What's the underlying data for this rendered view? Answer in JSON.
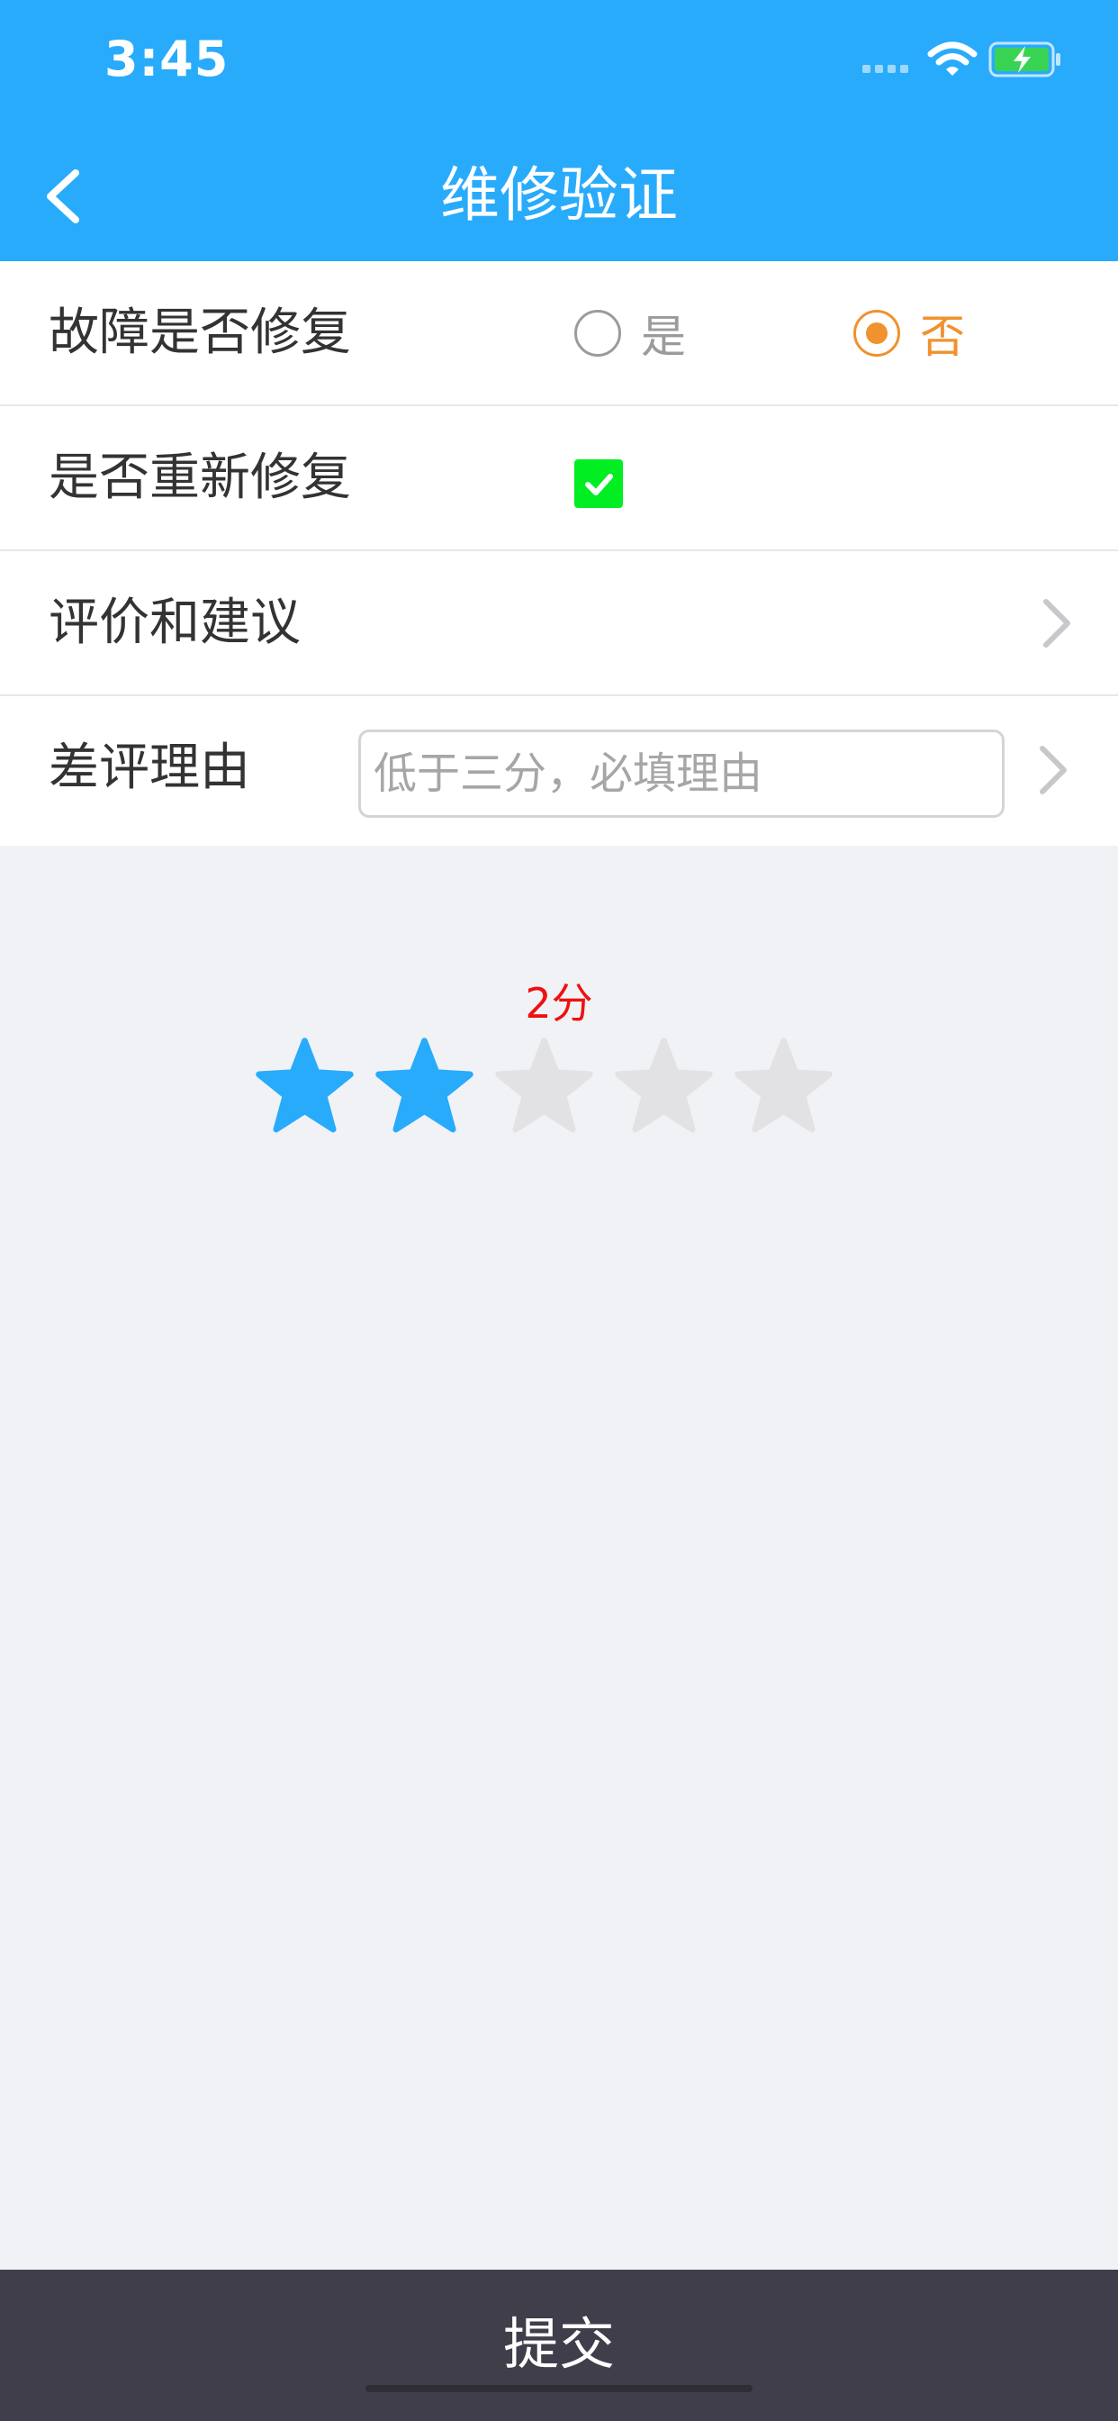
{
  "status_bar": {
    "time": "3:45",
    "icons": [
      "signal-icon",
      "wifi-icon",
      "battery-charging-icon"
    ]
  },
  "nav": {
    "title": "维修验证",
    "back_icon": "chevron-left-icon"
  },
  "form": {
    "fault_fixed": {
      "label": "故障是否修复",
      "options": [
        {
          "label": "是",
          "selected": false
        },
        {
          "label": "否",
          "selected": true
        }
      ]
    },
    "re_repair": {
      "label": "是否重新修复",
      "checked": true
    },
    "evaluation": {
      "label": "评价和建议"
    },
    "bad_review_reason": {
      "label": "差评理由",
      "value": "",
      "placeholder": "低于三分，必填理由"
    }
  },
  "rating": {
    "score_text": "2分",
    "value": 2,
    "max": 5
  },
  "submit_label": "提交",
  "colors": {
    "primary": "#29abfb",
    "accent": "#f0922e",
    "score": "#ee1111",
    "checkbox": "#00ee22",
    "submit_bg": "#3f3e4a",
    "star_off": "#e2e2e4"
  }
}
